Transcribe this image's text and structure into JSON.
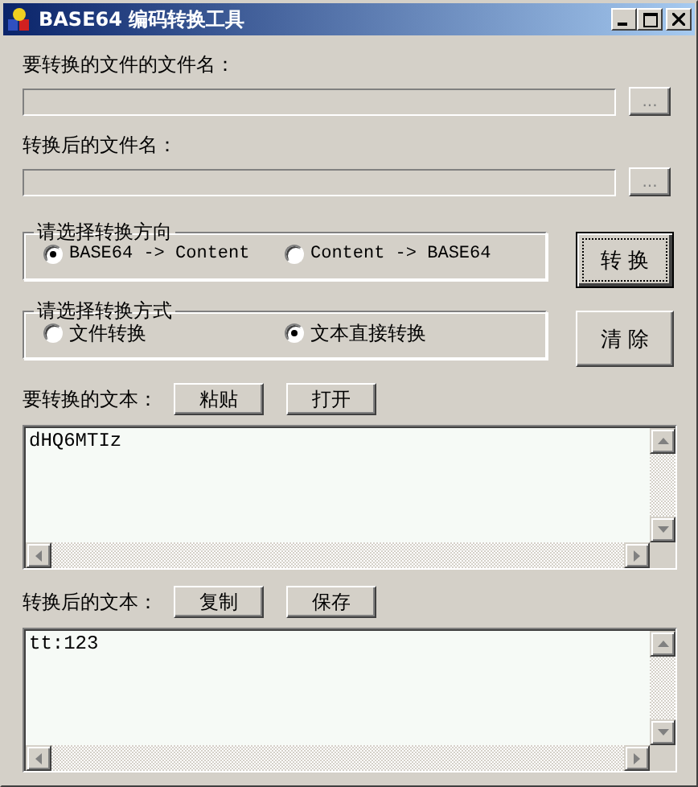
{
  "window": {
    "title": "BASE64 编码转换工具"
  },
  "file_fields": [
    {
      "label": "要转换的文件的文件名：",
      "disabled": true,
      "browse_label": "...",
      "browse_disabled": true
    },
    {
      "label": "转换后的文件名：",
      "disabled": true,
      "browse_label": "...",
      "browse_disabled": true
    }
  ],
  "direction_group": {
    "title": "请选择转换方向",
    "options": [
      {
        "label": "BASE64 -> Content",
        "selected": true
      },
      {
        "label": "Content -> BASE64",
        "selected": false
      }
    ]
  },
  "convert_button": {
    "label": "转 换",
    "default": true
  },
  "mode_group": {
    "title": "请选择转换方式",
    "options": [
      {
        "label": "文件转换",
        "selected": false
      },
      {
        "label": "文本直接转换",
        "selected": true
      }
    ]
  },
  "clear_button": {
    "label": "清 除",
    "default": false
  },
  "input_text": {
    "label": "要转换的文本：",
    "buttons": [
      "粘贴",
      "打开"
    ],
    "value": "dHQ6MTIz"
  },
  "output_text": {
    "label": "转换后的文本：",
    "buttons": [
      "复制",
      "保存"
    ],
    "value": "tt:123"
  }
}
